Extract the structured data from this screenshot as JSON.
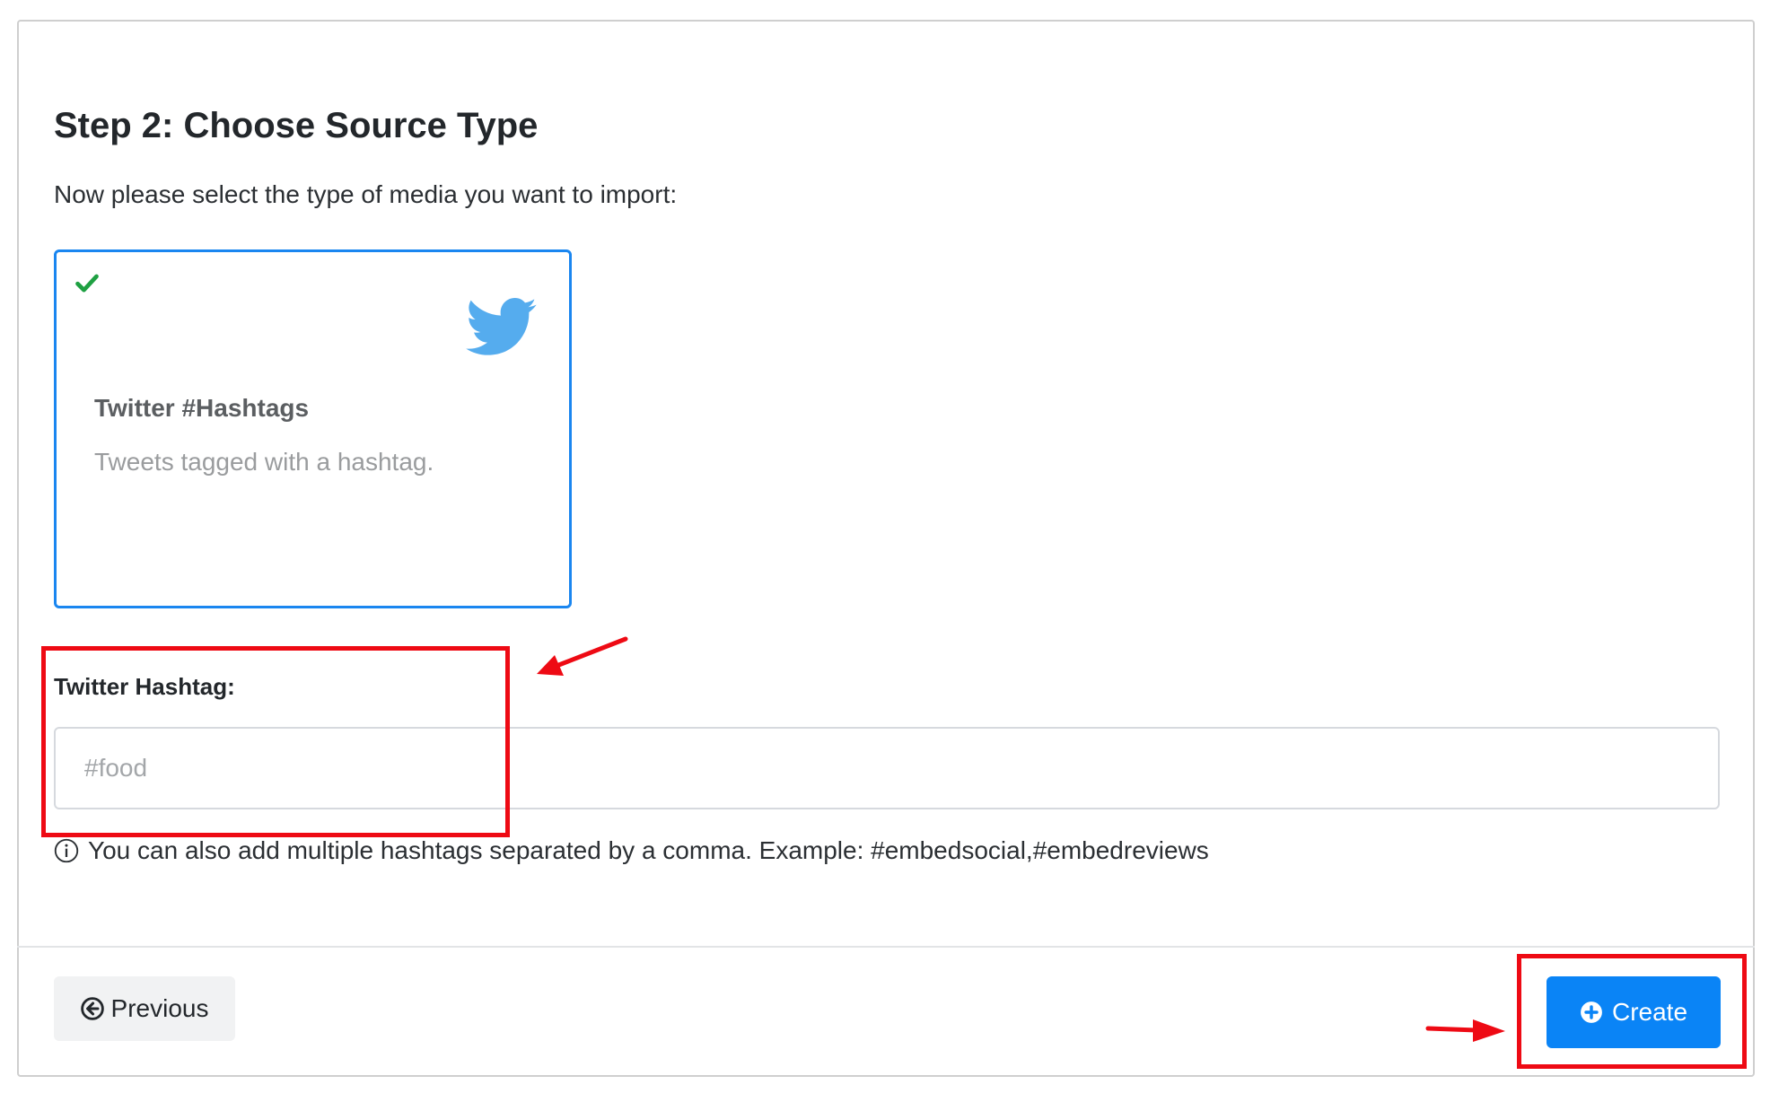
{
  "step": {
    "title": "Step 2: Choose Source Type",
    "subtitle": "Now please select the type of media you want to import:"
  },
  "source_card": {
    "title": "Twitter #Hashtags",
    "description": "Tweets tagged with a hashtag.",
    "selected": true,
    "icon": "twitter-bird-icon",
    "check_icon": "check-icon",
    "accent": "#1a86f0",
    "icon_color": "#55acee",
    "check_color": "#1ea042"
  },
  "hashtag_field": {
    "label": "Twitter Hashtag:",
    "value": "",
    "placeholder": "#food",
    "help_icon": "info-icon",
    "help": "You can also add multiple hashtags separated by a comma. Example: #embedsocial,#embedreviews"
  },
  "footer": {
    "previous_label": "Previous",
    "previous_icon": "arrow-left-circle-icon",
    "create_label": "Create",
    "create_icon": "plus-circle-icon",
    "create_color": "#0a84f6"
  },
  "annotations": {
    "color": "#ee0a14"
  }
}
